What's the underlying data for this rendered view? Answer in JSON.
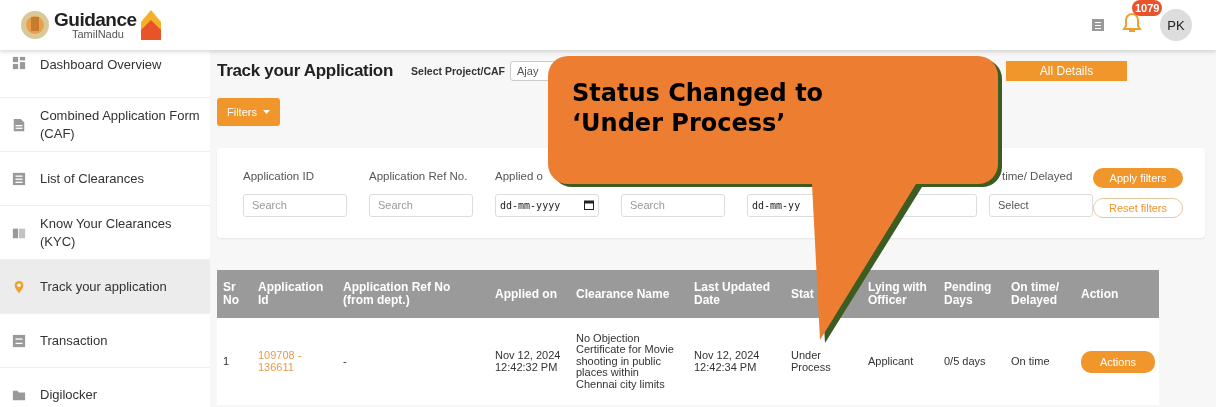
{
  "header": {
    "logo_title": "Guidance",
    "logo_subtitle": "TamilNadu",
    "notification_count": "1079",
    "avatar": "PK"
  },
  "sidebar": {
    "items": [
      {
        "label": "Dashboard Overview",
        "selected": false
      },
      {
        "label": "Combined Application Form (CAF)",
        "selected": false
      },
      {
        "label": "List of Clearances",
        "selected": false
      },
      {
        "label": "Know Your Clearances (KYC)",
        "selected": false
      },
      {
        "label": "Track your application",
        "selected": true
      },
      {
        "label": "Transaction",
        "selected": false
      },
      {
        "label": "Digilocker",
        "selected": false
      }
    ]
  },
  "page": {
    "title": "Track your Application",
    "project_label": "Select Project/CAF",
    "project_value": "Ajay",
    "all_details_button": "All Details",
    "filters_button": "Filters"
  },
  "filters": {
    "fields": [
      {
        "label": "Application ID",
        "kind": "text",
        "placeholder": "Search"
      },
      {
        "label": "Application Ref No.",
        "kind": "text",
        "placeholder": "Search"
      },
      {
        "label": "Applied o",
        "kind": "date",
        "value": "dd-mm-yyyy"
      },
      {
        "kind": "text",
        "placeholder": "Search"
      },
      {
        "kind": "date",
        "value": "dd-mm-yy"
      },
      {
        "kind": "text"
      },
      {
        "label": "time/ Delayed",
        "kind": "select",
        "value": "Select"
      }
    ],
    "apply_button": "Apply filters",
    "reset_button": "Reset filters"
  },
  "table": {
    "columns": [
      "Sr No",
      "Application Id",
      "Application Ref No (from dept.)",
      "Applied on",
      "Clearance Name",
      "Last Updated Date",
      "Stat",
      "Lying with Officer",
      "Pending Days",
      "On time/ Delayed",
      "Action"
    ],
    "rows": [
      {
        "cells": [
          "1",
          "109708 - 136611",
          "-",
          "Nov 12, 2024 12:42:32 PM",
          "No Objection Certificate for Movie shooting in public places within Chennai city limits",
          "Nov 12, 2024 12:42:34 PM",
          "Under Process",
          "Applicant",
          "0/5 days",
          "On time"
        ],
        "action": "Actions"
      }
    ]
  },
  "callout": {
    "text": "Status Changed to ‘Under Process’"
  }
}
